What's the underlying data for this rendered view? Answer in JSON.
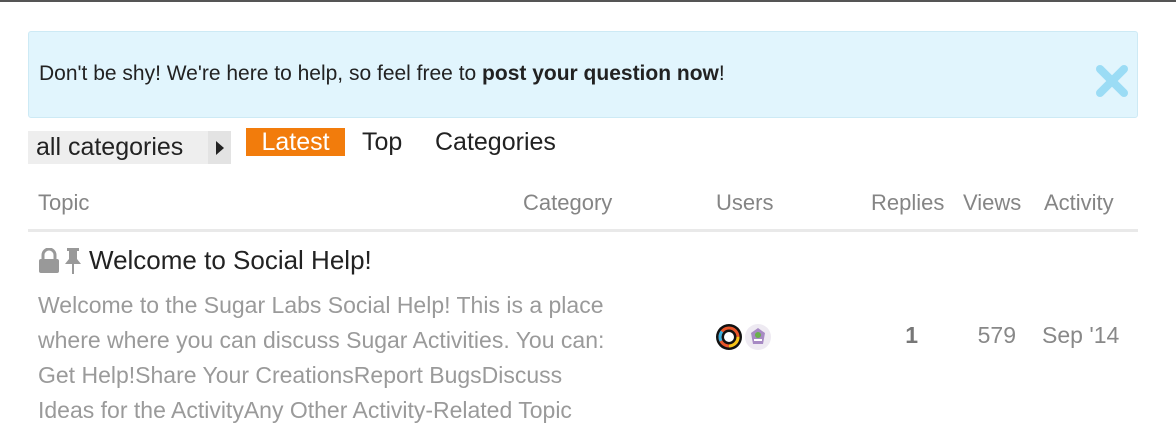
{
  "banner": {
    "text_before": "Don't be shy! We're here to help, so feel free to ",
    "link_text": "post your question now",
    "text_after": "!",
    "close_icon": "close-x-icon",
    "accent_color": "#e1f5fd"
  },
  "nav": {
    "breadcrumb_label": "all categories",
    "tabs": [
      {
        "label": "Latest",
        "active": true
      },
      {
        "label": "Top",
        "active": false
      },
      {
        "label": "Categories",
        "active": false
      }
    ],
    "active_color": "#f27c0c"
  },
  "table": {
    "columns": [
      "Topic",
      "Category",
      "Users",
      "Replies",
      "Views",
      "Activity"
    ],
    "rows": [
      {
        "title": "Welcome to Social Help!",
        "status_icons": [
          "lock-icon",
          "pin-icon"
        ],
        "excerpt_lines": [
          "Welcome to the Sugar Labs Social Help! This is a place",
          "where where you can discuss Sugar Activities. You can:",
          "Get Help!Share Your CreationsReport BugsDiscuss",
          "Ideas for the ActivityAny Other Activity-Related Topic"
        ],
        "users": [
          "user-avatar",
          "user-avatar"
        ],
        "replies": "1",
        "views": "579",
        "activity": "Sep '14"
      }
    ]
  }
}
